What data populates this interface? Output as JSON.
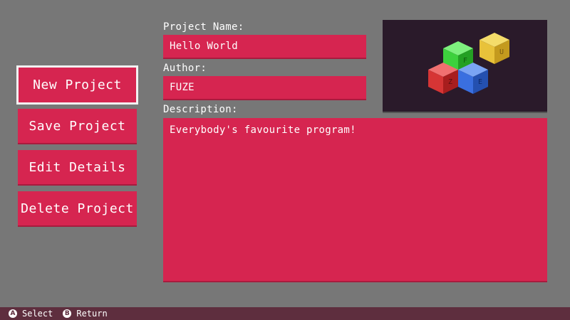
{
  "menu": {
    "items": [
      {
        "label": "New Project",
        "selected": true
      },
      {
        "label": "Save Project",
        "selected": false
      },
      {
        "label": "Edit Details",
        "selected": false
      },
      {
        "label": "Delete Project",
        "selected": false
      }
    ]
  },
  "form": {
    "project_name_label": "Project Name:",
    "project_name_value": "Hello World",
    "author_label": "Author:",
    "author_value": "FUZE",
    "description_label": "Description:",
    "description_value": "Everybody's favourite program!"
  },
  "logo": {
    "blocks": [
      {
        "letter": "F",
        "color": "#3dd13d"
      },
      {
        "letter": "U",
        "color": "#e8c23a"
      },
      {
        "letter": "Z",
        "color": "#d63535"
      },
      {
        "letter": "E",
        "color": "#3a6fe0"
      }
    ]
  },
  "footer": {
    "hints": [
      {
        "button": "A",
        "label": "Select"
      },
      {
        "button": "B",
        "label": "Return"
      }
    ]
  },
  "colors": {
    "background": "#777777",
    "accent": "#d62550",
    "footer_bar": "#5e2e3e"
  }
}
